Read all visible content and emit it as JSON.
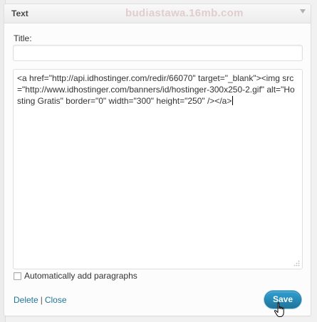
{
  "widget": {
    "title": "Text",
    "watermark": "budiastawa.16mb.com",
    "toggle_icon": "triangle-down-icon"
  },
  "form": {
    "title_label": "Title:",
    "title_value": "",
    "content": "<a href=\"http://api.idhostinger.com/redir/66070\" target=\"_blank\"><img src=\"http://www.idhostinger.com/banners/id/hostinger-300x250-2.gif\" alt=\"Hosting Gratis\" border=\"0\" width=\"300\" height=\"250\" /></a>",
    "autop_label": "Automatically add paragraphs",
    "autop_checked": false
  },
  "actions": {
    "delete_label": "Delete",
    "separator": "|",
    "close_label": "Close",
    "save_label": "Save"
  },
  "colors": {
    "link": "#21759b",
    "primary_button": "#21759b"
  }
}
